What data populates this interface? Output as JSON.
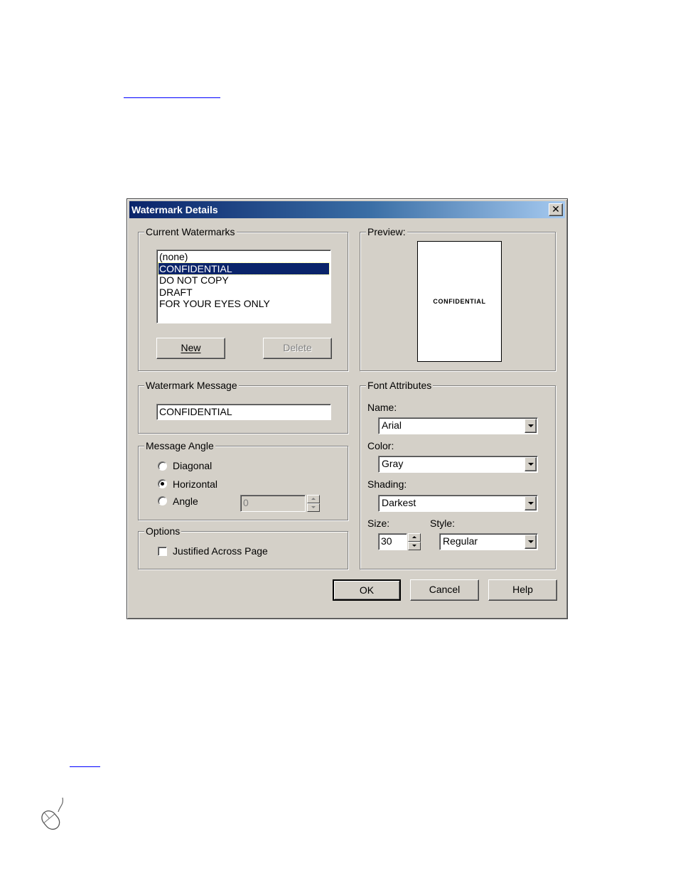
{
  "dialog": {
    "title": "Watermark Details",
    "close_glyph": "✕",
    "current_watermarks": {
      "legend": "Current Watermarks",
      "items": [
        "(none)",
        "CONFIDENTIAL",
        "DO NOT COPY",
        "DRAFT",
        "FOR YOUR EYES ONLY"
      ],
      "selected": "CONFIDENTIAL",
      "new_label": "New",
      "delete_label": "Delete"
    },
    "preview": {
      "legend": "Preview:",
      "text": "CONFIDENTIAL"
    },
    "watermark_message": {
      "legend": "Watermark Message",
      "value": "CONFIDENTIAL"
    },
    "message_angle": {
      "legend": "Message Angle",
      "options": [
        "Diagonal",
        "Horizontal",
        "Angle"
      ],
      "selected": "Horizontal",
      "angle_value": "0"
    },
    "options": {
      "legend": "Options",
      "justified_label": "Justified Across Page",
      "justified_checked": false
    },
    "font_attributes": {
      "legend": "Font Attributes",
      "name_label": "Name:",
      "name_value": "Arial",
      "color_label": "Color:",
      "color_value": "Gray",
      "shading_label": "Shading:",
      "shading_value": "Darkest",
      "size_label": "Size:",
      "size_value": "30",
      "style_label": "Style:",
      "style_value": "Regular"
    },
    "buttons": {
      "ok": "OK",
      "cancel": "Cancel",
      "help": "Help"
    },
    "colors": {
      "dialog_face": "#d4d0c8",
      "titlebar_start": "#0a246a",
      "titlebar_end": "#a6caf0",
      "selection": "#0a246a",
      "link": "#0000ff"
    }
  }
}
